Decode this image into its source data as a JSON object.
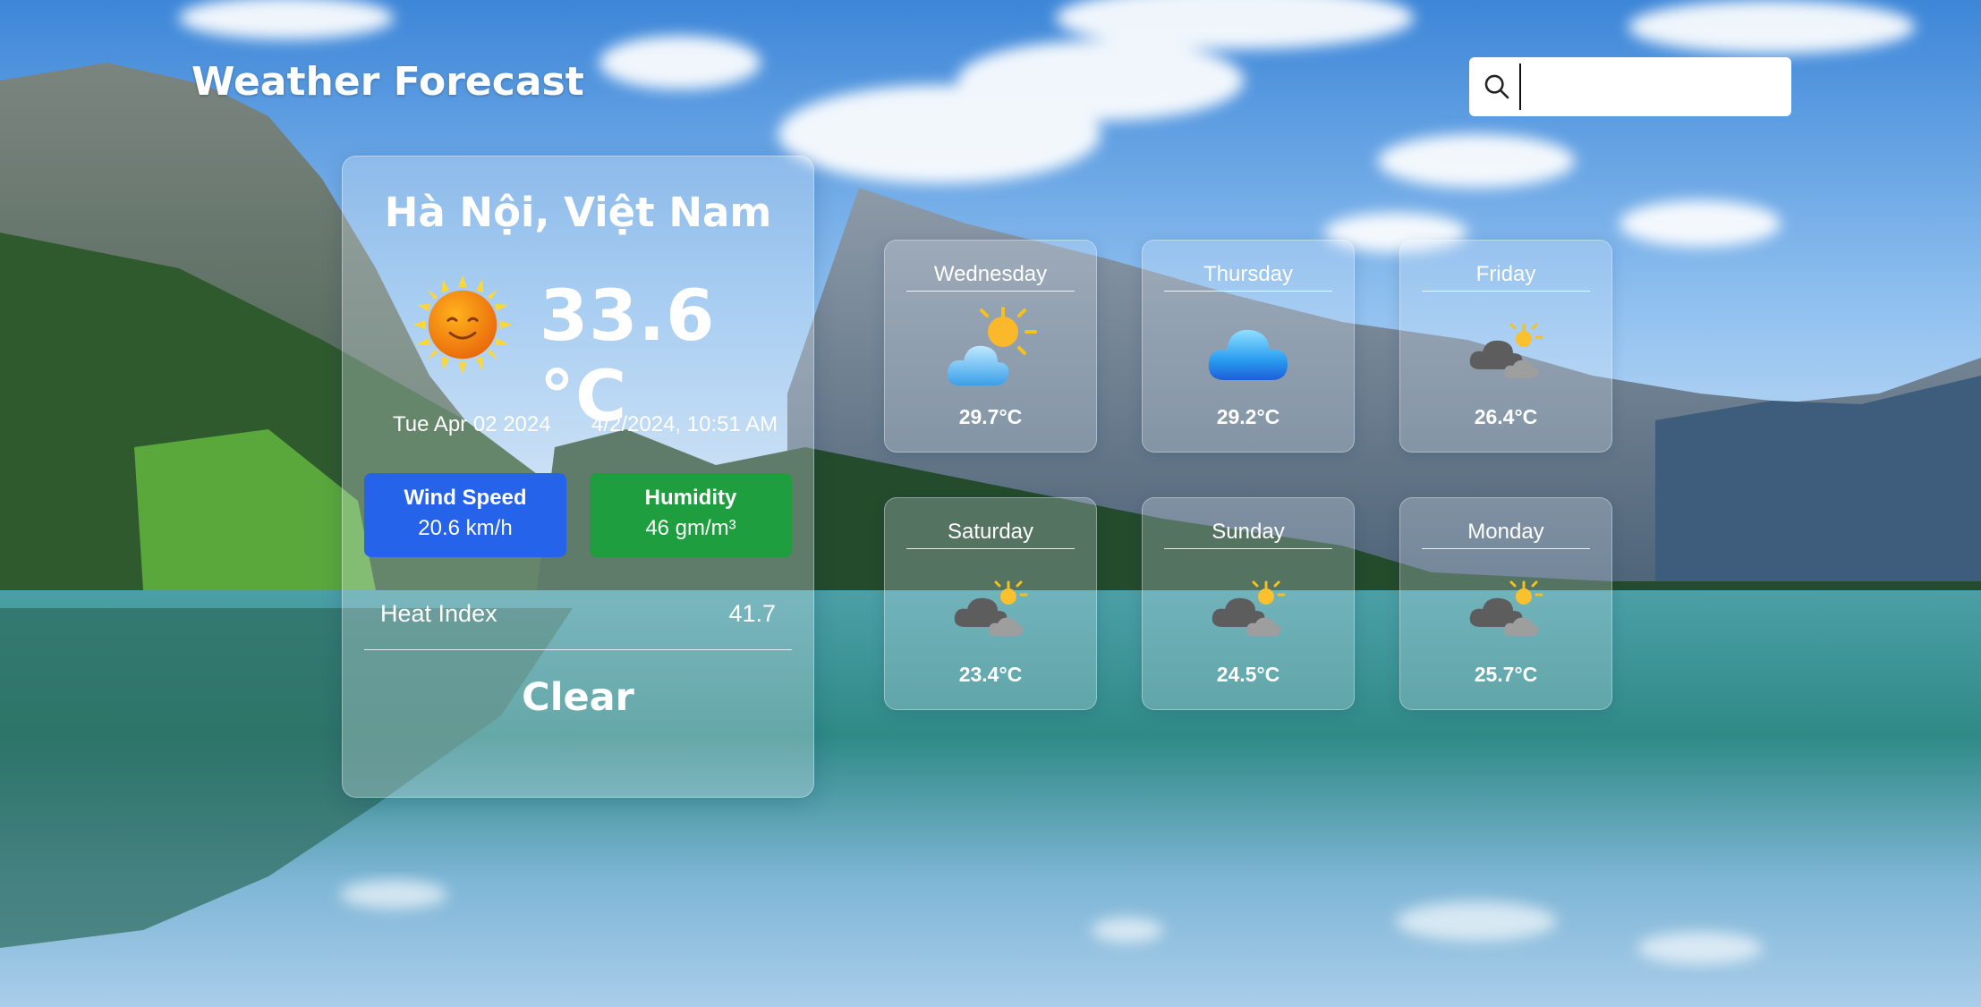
{
  "header": {
    "title": "Weather Forecast",
    "search": {
      "placeholder": "",
      "value": "",
      "icon": "search-icon"
    }
  },
  "current": {
    "city": "Hà Nội, Việt Nam",
    "icon": "sun-smiling-icon",
    "temperature": "33.6 °C",
    "date": "Tue Apr 02 2024",
    "datetime": "4/2/2024, 10:51 AM",
    "wind": {
      "label": "Wind Speed",
      "value": "20.6 km/h",
      "color": "#2563eb"
    },
    "humidity": {
      "label": "Humidity",
      "value": "46 gm/m³",
      "color": "#1e9e3e"
    },
    "heat_index": {
      "label": "Heat Index",
      "value": "41.7"
    },
    "condition": "Clear"
  },
  "forecast": [
    {
      "day": "Wednesday",
      "temp": "29.7°C",
      "icon": "sun-behind-cloud-icon"
    },
    {
      "day": "Thursday",
      "temp": "29.2°C",
      "icon": "cloud-icon"
    },
    {
      "day": "Friday",
      "temp": "26.4°C",
      "icon": "partly-cloudy-dark-icon"
    },
    {
      "day": "Saturday",
      "temp": "23.4°C",
      "icon": "partly-cloudy-dark-icon"
    },
    {
      "day": "Sunday",
      "temp": "24.5°C",
      "icon": "partly-cloudy-dark-icon"
    },
    {
      "day": "Monday",
      "temp": "25.7°C",
      "icon": "partly-cloudy-dark-icon"
    }
  ]
}
